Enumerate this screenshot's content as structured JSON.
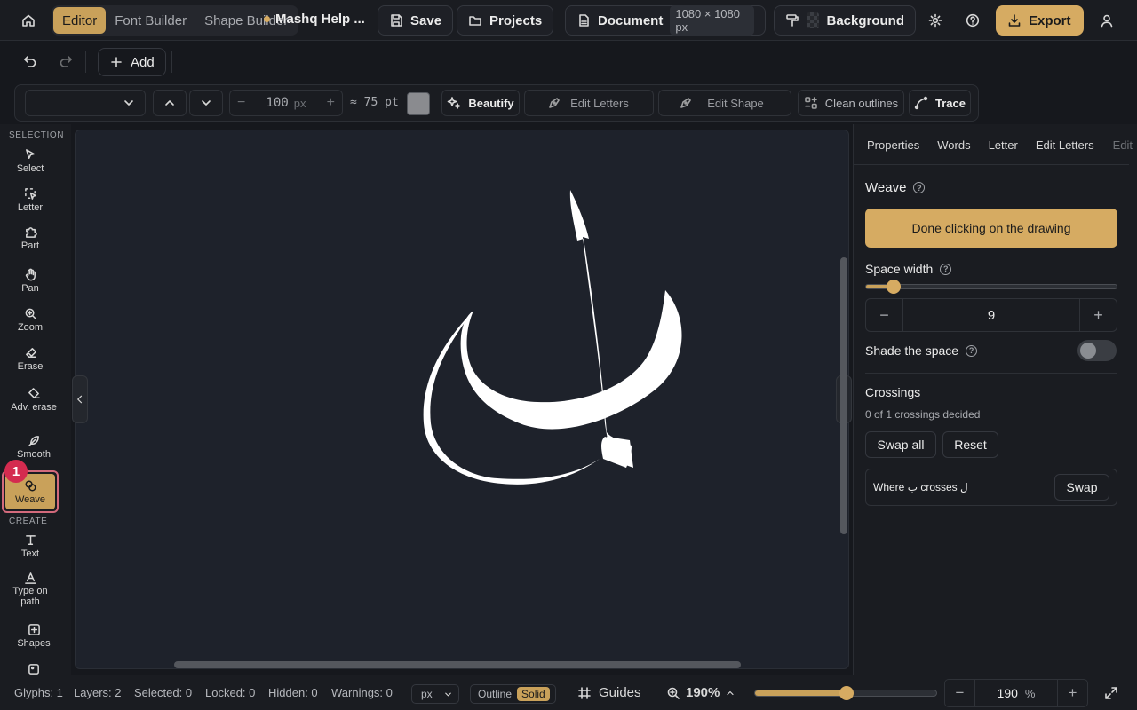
{
  "topbar": {
    "modes": [
      "Editor",
      "Font Builder",
      "Shape Builder"
    ],
    "active_mode": "Editor",
    "project_title": "Mashq Help ...",
    "save": "Save",
    "projects": "Projects",
    "document": "Document",
    "document_size": "1080 × 1080 px",
    "background": "Background",
    "export": "Export"
  },
  "row2": {
    "add": "Add"
  },
  "toolbar": {
    "font_size": "100",
    "font_unit": "px",
    "pt_approx": "≈ 75 pt",
    "beautify": "Beautify",
    "edit_letters": "Edit Letters",
    "edit_shape": "Edit Shape",
    "clean_outlines": "Clean outlines",
    "trace": "Trace",
    "swatch_color": "#8a8b8f"
  },
  "tools": {
    "selection_header": "SELECTION",
    "create_header": "CREATE",
    "select": "Select",
    "letter": "Letter",
    "part": "Part",
    "pan": "Pan",
    "zoom": "Zoom",
    "erase": "Erase",
    "adv_erase": "Adv. erase",
    "smooth": "Smooth",
    "weave": "Weave",
    "text": "Text",
    "type_on_path_1": "Type on",
    "type_on_path_2": "path",
    "shapes": "Shapes",
    "step_badge": "1"
  },
  "panel": {
    "tabs": [
      "Properties",
      "Words",
      "Letter",
      "Edit Letters",
      "Edit"
    ],
    "title": "Weave",
    "done_button": "Done clicking on the drawing",
    "space_width_label": "Space width",
    "space_width": "9",
    "space_width_fraction": 0.11,
    "shade_label": "Shade the space",
    "shade_on": false,
    "crossings_title": "Crossings",
    "crossings_status": "0 of 1 crossings decided",
    "swap_all": "Swap all",
    "reset": "Reset",
    "crossing_text": "Where ب crosses ل",
    "swap": "Swap"
  },
  "status": {
    "glyphs": "Glyphs: 1",
    "layers": "Layers: 2",
    "selected": "Selected: 0",
    "locked": "Locked: 0",
    "hidden": "Hidden: 0",
    "warnings": "Warnings: 0",
    "unit": "px",
    "outline": "Outline",
    "solid": "Solid",
    "guides": "Guides",
    "zoom_display": "190%",
    "zoom_value": "190",
    "zoom_unit": "%",
    "zoom_fraction": 0.505
  },
  "colors": {
    "accent": "#d6ab62",
    "badge": "#d42b4f"
  }
}
